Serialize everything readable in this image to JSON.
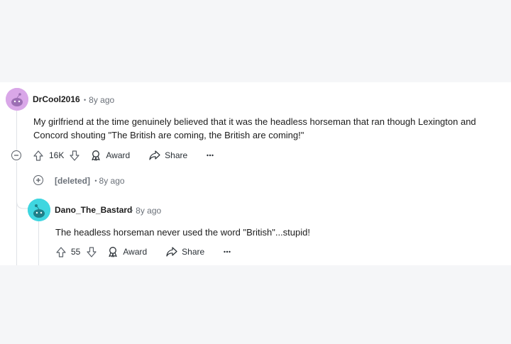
{
  "comments": [
    {
      "username": "DrCool2016",
      "time": "8y ago",
      "avatar_color": "#d9a7e8",
      "body": "My girlfriend at the time genuinely believed that it was the headless horseman that ran though Lexington and Concord shouting \"The British are coming, the British are coming!\"",
      "score": "16K",
      "award_label": "Award",
      "share_label": "Share"
    },
    {
      "username": "[deleted]",
      "time": "8y ago"
    },
    {
      "username": "Dano_The_Bastard",
      "time": "8y ago",
      "avatar_color": "#3fd6e0",
      "body": "The headless horseman never used the word \"British\"...stupid!",
      "score": "55",
      "award_label": "Award",
      "share_label": "Share"
    }
  ],
  "icons": {
    "collapse": "minus-circle-icon",
    "expand": "plus-circle-icon",
    "upvote": "arrow-up-icon",
    "downvote": "arrow-down-icon",
    "award": "award-icon",
    "share": "share-icon",
    "more": "ellipsis-icon"
  }
}
